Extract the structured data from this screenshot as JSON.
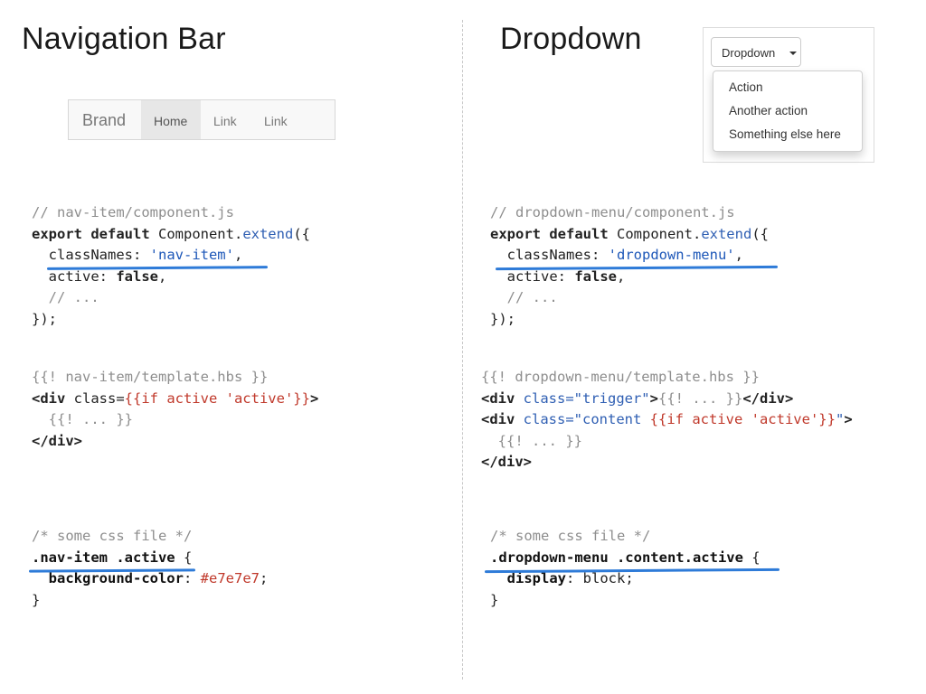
{
  "left": {
    "title": "Navigation Bar",
    "navbar": {
      "brand": "Brand",
      "items": [
        "Home",
        "Link",
        "Link"
      ],
      "active_item": "Home",
      "active_color": "#e7e7e7"
    },
    "js": {
      "comment": "// nav-item/component.js",
      "l1_kw": "export default",
      "l1_obj": " Component.",
      "l1_fn": "extend",
      "l1_end": "({",
      "l2_key": "  classNames: ",
      "l2_val": "'nav-item'",
      "l2_end": ",",
      "l3_key": "  active: ",
      "l3_val": "false",
      "l3_end": ",",
      "l4": "  // ...",
      "l5": "});"
    },
    "hbs": {
      "comment": "{{! nav-item/template.hbs }}",
      "l1_tag": "<div",
      "l1_attr": " class=",
      "l1_val": "{{if active 'active'}}",
      "l1_end": ">",
      "l2": "  {{! ... }}",
      "l3": "</div>"
    },
    "css": {
      "comment": "/* some css file */",
      "selector": ".nav-item .active",
      "open": " {",
      "prop": "  background-color",
      "colon": ": ",
      "value": "#e7e7e7",
      "semi": ";",
      "close": "}"
    }
  },
  "right": {
    "title": "Dropdown",
    "dropdown": {
      "button_label": "Dropdown",
      "items": [
        "Action",
        "Another action",
        "Something else here"
      ]
    },
    "js": {
      "comment": "// dropdown-menu/component.js",
      "l1_kw": "export default",
      "l1_obj": " Component.",
      "l1_fn": "extend",
      "l1_end": "({",
      "l2_key": "  classNames: ",
      "l2_val": "'dropdown-menu'",
      "l2_end": ",",
      "l3_key": "  active: ",
      "l3_val": "false",
      "l3_end": ",",
      "l4": "  // ...",
      "l5": "});"
    },
    "hbs": {
      "comment": "{{! dropdown-menu/template.hbs }}",
      "l1_tag": "<div",
      "l1_attr": " class=",
      "l1_val": "\"trigger\"",
      "l1_mid": ">",
      "l1_hbs": "{{! ... }}",
      "l1_close": "</div>",
      "l2_tag": "<div",
      "l2_attr": " class=",
      "l2_val1": "\"content ",
      "l2_val2": "{{if active 'active'}}",
      "l2_val3": "\"",
      "l2_end": ">",
      "l3": "  {{! ... }}",
      "l4": "</div>"
    },
    "css": {
      "comment": "/* some css file */",
      "selector": ".dropdown-menu .content.active",
      "open": " {",
      "prop": "  display",
      "colon": ": ",
      "value": "block",
      "semi": ";",
      "close": "}"
    }
  },
  "colors": {
    "underline": "#2e7bd8",
    "comment": "#8e8e8e",
    "string": "#1d57b8",
    "hbs_red": "#c0392b"
  }
}
